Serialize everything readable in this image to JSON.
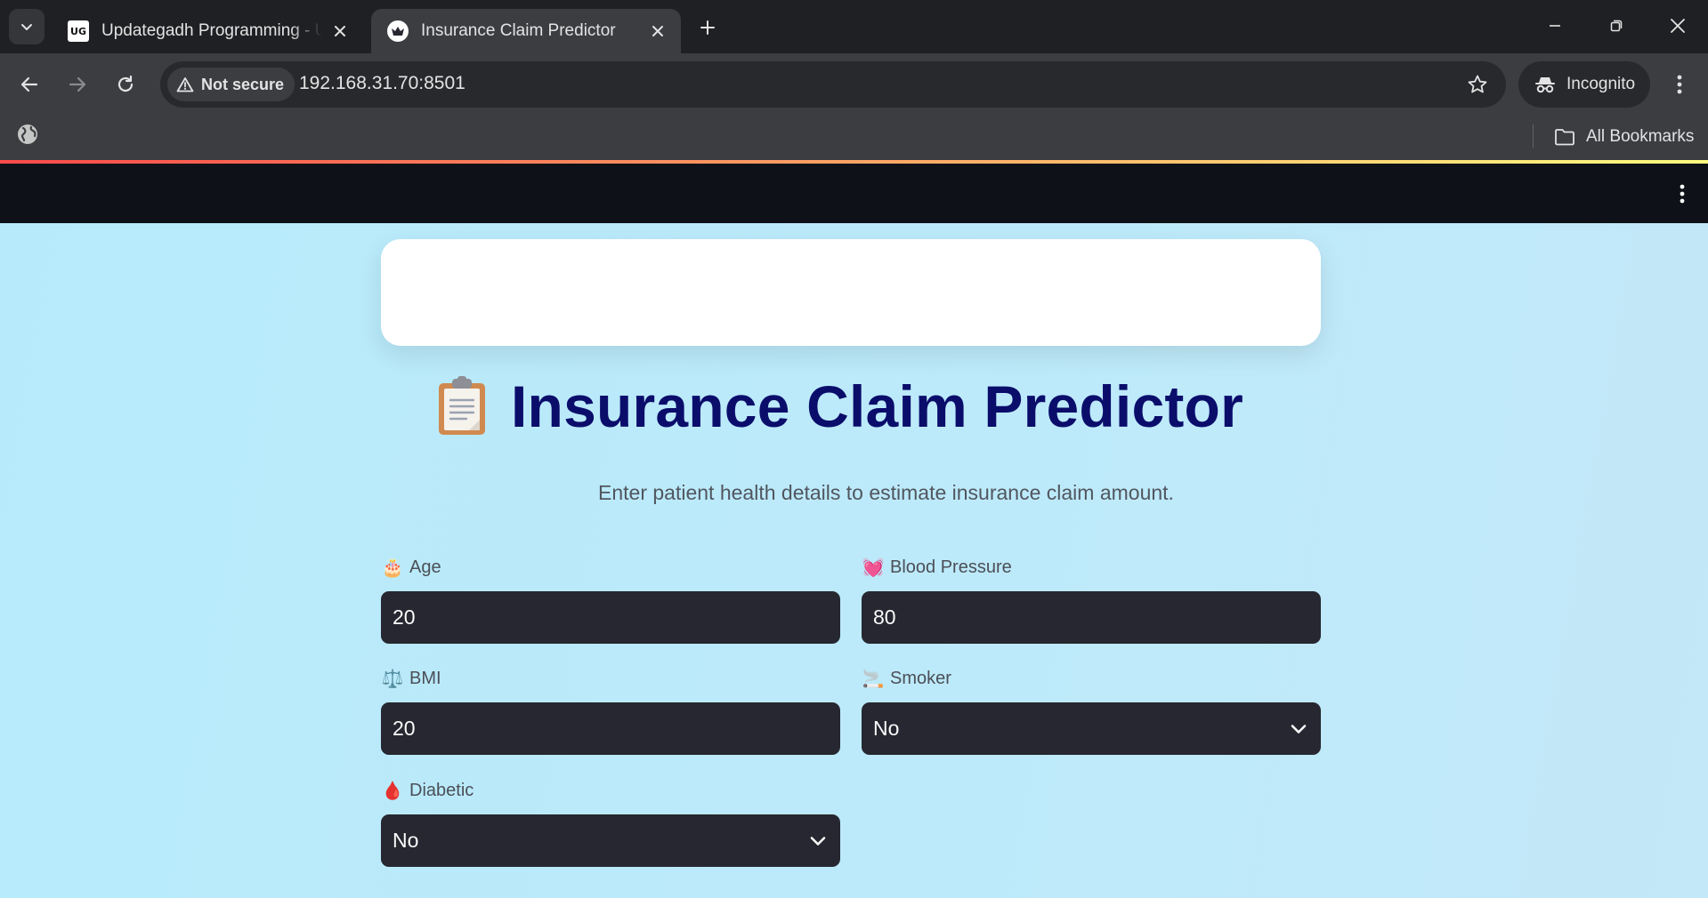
{
  "browser": {
    "tabs": [
      {
        "title": "Updategadh Programming - Up",
        "favicon": "updategadh-logo-icon",
        "active": false
      },
      {
        "title": "Insurance Claim Predictor",
        "favicon": "streamlit-crown-icon",
        "active": true
      }
    ],
    "favicon_text": "UG",
    "security_chip": "Not secure",
    "url": "192.168.31.70:8501",
    "profile": "Incognito",
    "bookmarks_label": "All Bookmarks"
  },
  "app": {
    "title_emoji": "📋",
    "title": "Insurance Claim Predictor",
    "subtitle": "Enter patient health details to estimate insurance claim amount.",
    "fields": {
      "age": {
        "emoji": "🎂",
        "label": "Age",
        "value": "20"
      },
      "blood_pressure": {
        "emoji": "💓",
        "label": "Blood Pressure",
        "value": "80"
      },
      "bmi": {
        "emoji": "⚖️",
        "label": "BMI",
        "value": "20"
      },
      "smoker": {
        "emoji": "🚬",
        "label": "Smoker",
        "value": "No"
      },
      "diabetic": {
        "emoji": "🩸",
        "label": "Diabetic",
        "value": "No"
      }
    }
  },
  "colors": {
    "page_bg": "#b9eafa",
    "title": "#0b0d6b",
    "input_bg": "#262730",
    "chrome_dark": "#1f2023",
    "chrome_toolbar": "#3c3d41"
  }
}
